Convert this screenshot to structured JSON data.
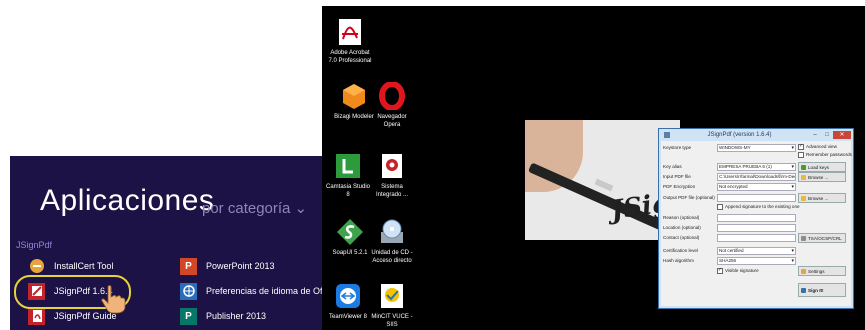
{
  "start_screen": {
    "title": "Aplicaciones",
    "subtitle": "por categoría ⌄",
    "group_label": "JSignPdf",
    "apps_col1": [
      {
        "label": "InstallCert Tool",
        "icon": "installcert-icon",
        "color": "#e8a33a"
      },
      {
        "label": "JSignPdf 1.6.4",
        "icon": "jsignpdf-icon",
        "color": "#c4232c"
      },
      {
        "label": "JSignPdf Guide",
        "icon": "pdf-guide-icon",
        "color": "#c4232c"
      }
    ],
    "apps_col2": [
      {
        "label": "PowerPoint 2013",
        "icon": "powerpoint-icon",
        "badge": "P",
        "color": "#d24726"
      },
      {
        "label": "Preferencias de idioma de Office...",
        "icon": "office-language-icon",
        "color": "#2a6ebb"
      },
      {
        "label": "Publisher 2013",
        "icon": "publisher-icon",
        "badge": "P",
        "color": "#077568"
      }
    ],
    "highlight_color": "#e8d23a"
  },
  "desktop": {
    "icons": [
      {
        "label": "Adobe Acrobat\n7.0 Professional",
        "icon": "acrobat-icon"
      },
      {
        "label": "Bizagi Modeler",
        "icon": "bizagi-icon"
      },
      {
        "label": "Navegador\nOpera",
        "icon": "opera-icon"
      },
      {
        "label": "Camtasia Studio\n8",
        "icon": "camtasia-icon"
      },
      {
        "label": "Sistema\nIntegrado ...",
        "icon": "sistema-icon"
      },
      {
        "label": "SoapUI 5.2.1",
        "icon": "soapui-icon"
      },
      {
        "label": "Unidad de CD -\nAcceso directo",
        "icon": "cd-drive-icon"
      },
      {
        "label": "TeamViewer 8",
        "icon": "teamviewer-icon"
      },
      {
        "label": "MinCIT VUCE -\nSIIS",
        "icon": "mincit-icon"
      }
    ],
    "splash_logo": "JSig"
  },
  "dialog": {
    "title": "JSignPdf (version 1.6.4)",
    "labels": {
      "keystore_type": "Keystore type",
      "key_alias": "Key alias",
      "input_pdf": "Input PDF file",
      "pdf_encryption": "PDF Encryption",
      "output_pdf": "Output PDF file (optional)",
      "reason": "Reason (optional)",
      "location": "Location (optional)",
      "contact": "Contact (optional)",
      "cert_level": "Certification level",
      "hash_algo": "Hash algorithm"
    },
    "values": {
      "keystore_type": "WINDOWS-MY",
      "key_alias": "EMPRESA PRUEBA 6 (1)",
      "input_pdf": "C:\\Users\\rrfarmal\\Downloads\\firm-Declr",
      "pdf_encryption": "Not encrypted",
      "cert_level": "Not certified",
      "hash_algo": "SHA256"
    },
    "checkboxes": {
      "advanced_view": "Advanced view",
      "remember_passwords": "Remember passwords",
      "append_signature": "Append signature to the existing one",
      "visible_signature": "Visible signature"
    },
    "buttons": {
      "load_keys": "Load keys",
      "browse1": "Browse ...",
      "browse2": "Browse ...",
      "tsa": "TSA/OCSP/CRL",
      "settings": "Settings",
      "sign": "Sign It!"
    }
  }
}
